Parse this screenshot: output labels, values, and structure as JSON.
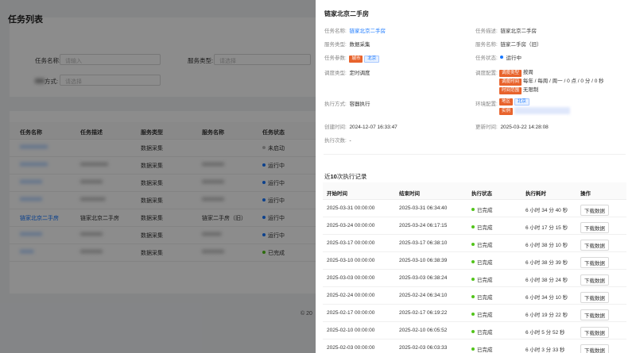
{
  "background": {
    "page_title": "任务列表",
    "filters": {
      "task_name_label": "任务名称:",
      "task_name_placeholder": "请输入",
      "service_type_label": "服务类型:",
      "service_type_placeholder": "请选择",
      "exec_mode_label": "方式:",
      "exec_mode_placeholder": "请选择"
    },
    "table": {
      "columns": [
        "任务名称",
        "任务描述",
        "服务类型",
        "服务名称",
        "任务状态"
      ],
      "rows": [
        {
          "name": "xxxxxxxxxx",
          "desc": "",
          "type": "数据采集",
          "service": "",
          "status": "未启动",
          "status_color": "#bbbbbb"
        },
        {
          "name": "xxxxxxxxxx",
          "desc": "xxxxxxxxxx",
          "type": "数据采集",
          "service": "xxxxxxxx",
          "status": "运行中",
          "status_color": "#1677ff"
        },
        {
          "name": "xxxxxxxx",
          "desc": "xxxxxxxx",
          "type": "数据采集",
          "service": "xxxxxxxx",
          "status": "运行中",
          "status_color": "#1677ff"
        },
        {
          "name": "xxxxxxxx",
          "desc": "xxxxxxxxx",
          "type": "数据采集",
          "service": "xxxxxxxx",
          "status": "运行中",
          "status_color": "#1677ff"
        },
        {
          "name": "链家北京二手房",
          "desc": "链家北京二手房",
          "type": "数据采集",
          "service": "链家二手房（旧）",
          "status": "运行中",
          "status_color": "#1677ff"
        },
        {
          "name": "xxxxxxxx",
          "desc": "xxxxxxxx",
          "type": "数据采集",
          "service": "xxxxxxx",
          "status": "运行中",
          "status_color": "#1677ff"
        },
        {
          "name": "xxxxx",
          "desc": "xxxxxxxx",
          "type": "数据采集",
          "service": "xxxxxxxx",
          "status": "已完成",
          "status_color": "#52c41a"
        }
      ]
    },
    "footer": "© 20"
  },
  "drawer": {
    "title": "链家北京二手房",
    "fields": {
      "task_name_label": "任务名称:",
      "task_name_value": "链家北京二手房",
      "task_desc_label": "任务描述:",
      "task_desc_value": "链家北京二手房",
      "service_type_label": "服务类型:",
      "service_type_value": "数据采集",
      "service_name_label": "服务名称:",
      "service_name_value": "链家二手房（旧）",
      "task_params_label": "任务参数:",
      "task_params_tag": "城市",
      "task_params_value": "北京",
      "task_status_label": "任务状态:",
      "task_status_value": "运行中",
      "schedule_type_label": "调度类型:",
      "schedule_type_value": "定时调度",
      "schedule_config_label": "调度配置:",
      "schedule_config": [
        {
          "tag": "调度类型",
          "value": "按周"
        },
        {
          "tag": "调度时间",
          "value": "每年 / 每周 / 周一 / 0 点 / 0 分 / 0 秒"
        },
        {
          "tag": "时间范围",
          "value": "无限制"
        }
      ],
      "exec_mode_label": "执行方式:",
      "exec_mode_value": "容器执行",
      "env_config_label": "环境配置:",
      "env_region_tag": "地区",
      "env_region_value": "北京",
      "env_instance_tag": "实例",
      "created_label": "创建时间:",
      "created_value": "2024-12-07 16:33:47",
      "updated_label": "更新时间:",
      "updated_value": "2025-03-22 14:28:08",
      "exec_count_label": "执行次数:",
      "exec_count_value": "-"
    },
    "records": {
      "title_prefix": "近",
      "title_num": "10",
      "title_suffix": "次执行记录",
      "columns": [
        "开始时间",
        "结束时间",
        "执行状态",
        "执行耗时",
        "操作"
      ],
      "download_label": "下载数据",
      "rows": [
        {
          "start": "2025-03-31 00:00:00",
          "end": "2025-03-31 06:34:40",
          "status": "已完成",
          "duration": "6 小时 34 分 40 秒"
        },
        {
          "start": "2025-03-24 00:00:00",
          "end": "2025-03-24 06:17:15",
          "status": "已完成",
          "duration": "6 小时 17 分 15 秒"
        },
        {
          "start": "2025-03-17 00:00:00",
          "end": "2025-03-17 06:38:10",
          "status": "已完成",
          "duration": "6 小时 38 分 10 秒"
        },
        {
          "start": "2025-03-10 00:00:00",
          "end": "2025-03-10 06:38:39",
          "status": "已完成",
          "duration": "6 小时 38 分 39 秒"
        },
        {
          "start": "2025-03-03 00:00:00",
          "end": "2025-03-03 06:38:24",
          "status": "已完成",
          "duration": "6 小时 38 分 24 秒"
        },
        {
          "start": "2025-02-24 00:00:00",
          "end": "2025-02-24 06:34:10",
          "status": "已完成",
          "duration": "6 小时 34 分 10 秒"
        },
        {
          "start": "2025-02-17 00:00:00",
          "end": "2025-02-17 06:19:22",
          "status": "已完成",
          "duration": "6 小时 19 分 22 秒"
        },
        {
          "start": "2025-02-10 00:00:00",
          "end": "2025-02-10 06:05:52",
          "status": "已完成",
          "duration": "6 小时 5 分 52 秒"
        },
        {
          "start": "2025-02-03 00:00:00",
          "end": "2025-02-03 06:03:33",
          "status": "已完成",
          "duration": "6 小时 3 分 33 秒"
        }
      ]
    }
  },
  "colors": {
    "accent": "#1677ff",
    "success": "#52c41a",
    "tag_orange": "#e8632c"
  }
}
